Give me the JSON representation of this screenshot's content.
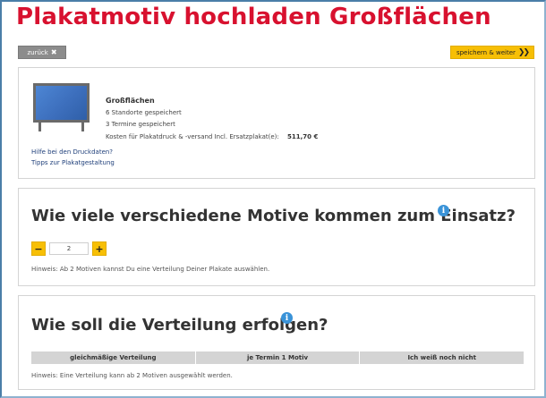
{
  "header": {
    "title": "Plakatmotiv hochladen Großflächen"
  },
  "toolbar": {
    "back_label": "zurück",
    "back_icon": "close-icon",
    "save_label": "speichern & weiter",
    "save_icon": "double-chevron-right-icon"
  },
  "summary": {
    "title": "Großflächen",
    "locations": "6 Standorte gespeichert",
    "dates": "3 Termine gespeichert",
    "cost_label": "Kosten für Plakatdruck & -versand Incl. Ersatzplakat(e):",
    "cost_value": "511,70 €",
    "help_links": [
      "Hilfe bei den Druckdaten?",
      "Tipps zur Plakatgestaltung"
    ]
  },
  "motifs": {
    "heading": "Wie viele verschiedene Motive kommen zum Einsatz?",
    "minus": "−",
    "plus": "+",
    "count": "2",
    "hint": "Hinweis: Ab 2 Motiven kannst Du eine Verteilung Deiner Plakate auswählen."
  },
  "distribution": {
    "heading": "Wie soll die Verteilung erfolgen?",
    "options": [
      "gleichmäßige Verteilung",
      "je Termin 1 Motiv",
      "Ich weiß noch nicht"
    ],
    "hint": "Hinweis: Eine Verteilung kann ab 2 Motiven ausgewählt werden."
  },
  "icons": {
    "info": "i"
  },
  "colors": {
    "title_red": "#d8112f",
    "accent_yellow": "#f7bf05",
    "info_blue": "#3a93d8",
    "back_gray": "#8c8c8c"
  }
}
